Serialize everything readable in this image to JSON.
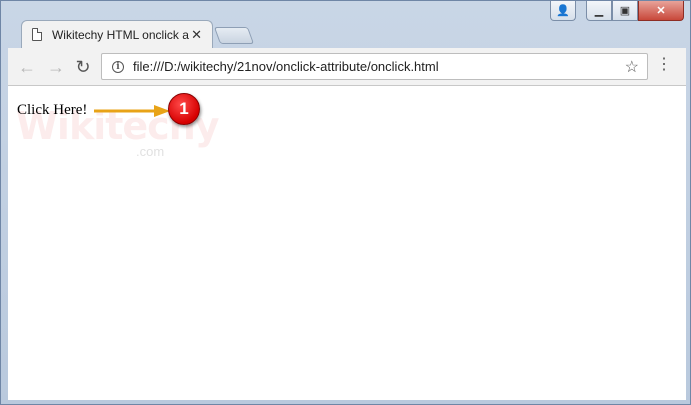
{
  "browser": {
    "tab": {
      "title": "Wikitechy HTML onclick a",
      "close_glyph": "✕"
    },
    "nav": {
      "back_glyph": "←",
      "forward_glyph": "→",
      "reload_glyph": "↻"
    },
    "address_bar": {
      "url": "file:///D:/wikitechy/21nov/onclick-attribute/onclick.html",
      "info_glyph": "i"
    },
    "star_glyph": "☆",
    "menu_glyph": "⋮"
  },
  "page": {
    "link_text": "Click Here!",
    "marker_number": "1",
    "watermark": "Wikitechy",
    "watermark_suffix": ".com"
  },
  "colors": {
    "marker": "#e00000",
    "arrow": "#e8a317"
  }
}
